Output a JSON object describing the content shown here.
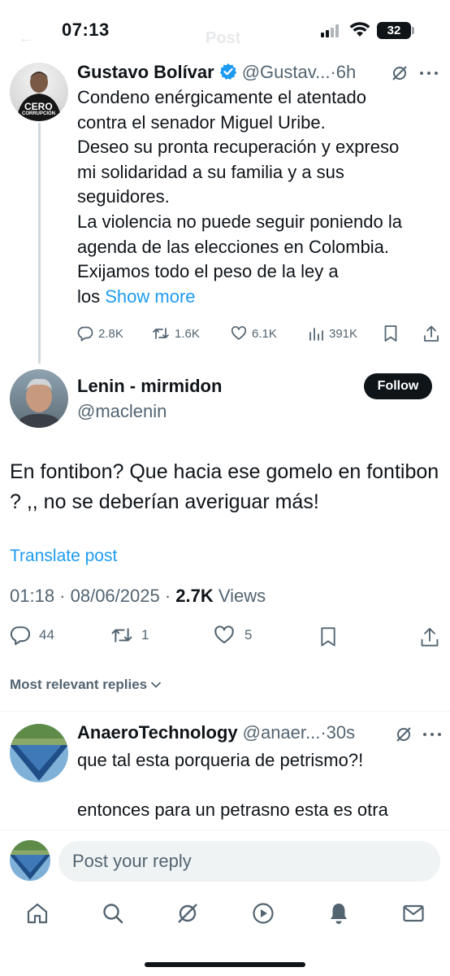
{
  "status_bar": {
    "time": "07:13",
    "battery": "32"
  },
  "faded_header": {
    "back": "←",
    "title": "Post"
  },
  "parent_tweet": {
    "name": "Gustavo Bolívar",
    "handle_time": "@Gustav...·6h",
    "lines": [
      "Condeno enérgicamente el atentado",
      "contra el senador Miguel Uribe.",
      "Deseo su pronta recuperación y expreso",
      "mi solidaridad a su familia y a sus",
      "seguidores.",
      "La violencia no puede seguir poniendo la",
      "agenda de las elecciones en Colombia.",
      "Exijamos todo el peso de la ley a"
    ],
    "last_line_prefix": "los",
    "show_more": "Show more",
    "avatar_text_1": "CERO",
    "avatar_text_2": "CORRUPCIÓN",
    "stats": {
      "replies": "2.8K",
      "reposts": "1.6K",
      "likes": "6.1K",
      "views": "391K"
    }
  },
  "main_tweet": {
    "name": "Lenin - mirmidon",
    "handle": "@maclenin",
    "follow_label": "Follow",
    "text": "En fontibon? Que hacia ese gomelo en fontibon ? ,, no se deberían averiguar más!",
    "translate": "Translate post",
    "timestamp": "01:18 · 08/06/2025 · ",
    "views_count": "2.7K",
    "views_label": " Views",
    "stats": {
      "replies": "44",
      "reposts": "1",
      "likes": "5"
    }
  },
  "replies_filter": {
    "label": "Most relevant replies"
  },
  "reply_tweet": {
    "name": "AnaeroTechnology",
    "handle_time": "@anaer...·30s",
    "line_1": "que tal esta porqueria de petrismo?!",
    "line_2": "entonces para un petrasno esta es otra"
  },
  "reply_bar": {
    "placeholder": "Post your reply"
  },
  "tab_bar": {
    "items": [
      "home-icon",
      "search-icon",
      "grok-icon",
      "video-icon",
      "notifications-icon",
      "messages-icon"
    ]
  },
  "colors": {
    "accent": "#1d9bf0",
    "text": "#0f1419",
    "secondary": "#536471",
    "verified": "#1d9bf0"
  }
}
